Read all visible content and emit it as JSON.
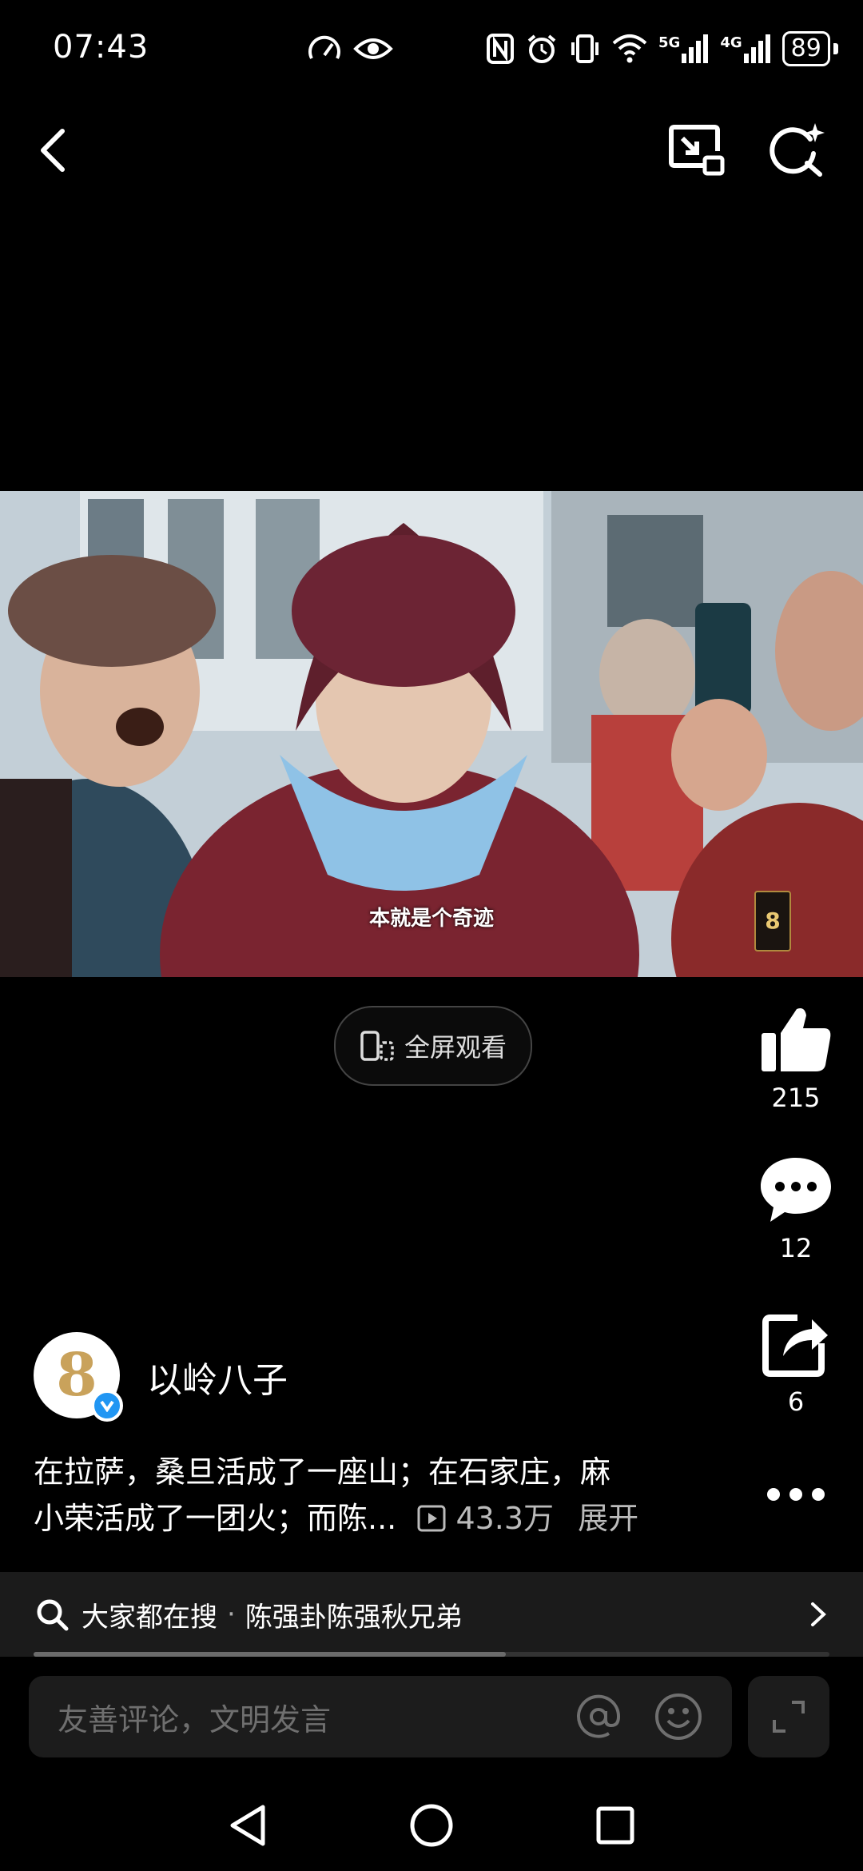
{
  "status_bar": {
    "time": "07:43",
    "left_icons": [
      "speedometer-icon",
      "eye-icon"
    ],
    "right_icons": [
      "nfc-icon",
      "alarm-icon",
      "vibrate-icon",
      "wifi-icon",
      "signal-5g-icon",
      "signal-4g-icon"
    ],
    "net1": "5G",
    "net2": "4G",
    "battery": "89"
  },
  "top_bar": {
    "back_icon": "back-arrow-icon",
    "pip_icon": "picture-in-picture-icon",
    "search_icon": "sparkle-search-icon"
  },
  "video": {
    "subtitle": "本就是个奇迹",
    "watermark_digit": "8"
  },
  "fullscreen": {
    "label": "全屏观看"
  },
  "actions": {
    "like_count": "215",
    "comment_count": "12",
    "share_count": "6"
  },
  "author": {
    "name": "以岭八子",
    "avatar_digit": "8",
    "verified": true
  },
  "description": {
    "text_line1": "在拉萨，桑旦活成了一座山；在石家庄，麻",
    "text_line2": "小荣活成了一团火；而陈...",
    "views": "43.3万",
    "expand": "展开"
  },
  "hot_search": {
    "prefix": "大家都在搜",
    "separator": "·",
    "query": "陈强卦陈强秋兄弟"
  },
  "progress": {
    "fraction": 0.593
  },
  "comment_bar": {
    "placeholder": "友善评论，文明发言"
  },
  "colors": {
    "background": "#000000",
    "panel": "#1c1c1c",
    "accent_blue": "#2196f3",
    "avatar_gold": "#c9a25b"
  }
}
